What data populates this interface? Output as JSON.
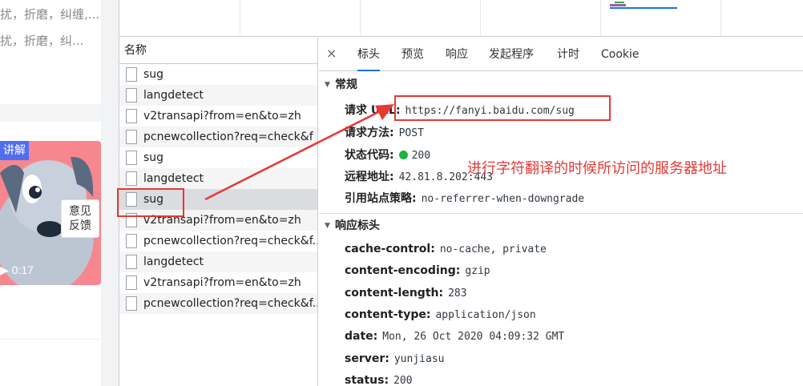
{
  "left_page": {
    "snippet_1": "扰，折磨，纠缠,...",
    "snippet_2": "扰，折磨，纠...",
    "video_tag": "讲解",
    "video_duration": "▶ 0:17",
    "feedback_line1": "意见",
    "feedback_line2": "反馈"
  },
  "request_list": {
    "header": "名称",
    "rows": [
      "sug",
      "langdetect",
      "v2transapi?from=en&to=zh",
      "pcnewcollection?req=check&f",
      "sug",
      "langdetect",
      "sug",
      "v2transapi?from=en&to=zh",
      "pcnewcollection?req=check&f...",
      "langdetect",
      "v2transapi?from=en&to=zh",
      "pcnewcollection?req=check&f..."
    ],
    "selected_index": 6
  },
  "detail": {
    "close": "×",
    "tabs": [
      "标头",
      "预览",
      "响应",
      "发起程序",
      "计时",
      "Cookie"
    ],
    "active_tab": 0,
    "general": {
      "title": "常规",
      "request_url_label": "请求 URL:",
      "request_url": "https://fanyi.baidu.com/sug",
      "request_method_label": "请求方法:",
      "request_method": "POST",
      "status_code_label": "状态代码:",
      "status_code": "200",
      "remote_address_label": "远程地址:",
      "remote_address": "42.81.8.202:443",
      "referrer_policy_label": "引用站点策略:",
      "referrer_policy": "no-referrer-when-downgrade"
    },
    "response_headers": {
      "title": "响应标头",
      "items": [
        {
          "k": "cache-control:",
          "v": "no-cache, private"
        },
        {
          "k": "content-encoding:",
          "v": "gzip"
        },
        {
          "k": "content-length:",
          "v": "283"
        },
        {
          "k": "content-type:",
          "v": "application/json"
        },
        {
          "k": "date:",
          "v": "Mon, 26 Oct 2020 04:09:32 GMT"
        },
        {
          "k": "server:",
          "v": "yunjiasu"
        },
        {
          "k": "status:",
          "v": "200"
        }
      ]
    }
  },
  "annotation": {
    "text": "进行字符翻译的时候所访问的服务器地址",
    "color": "#e53935"
  }
}
